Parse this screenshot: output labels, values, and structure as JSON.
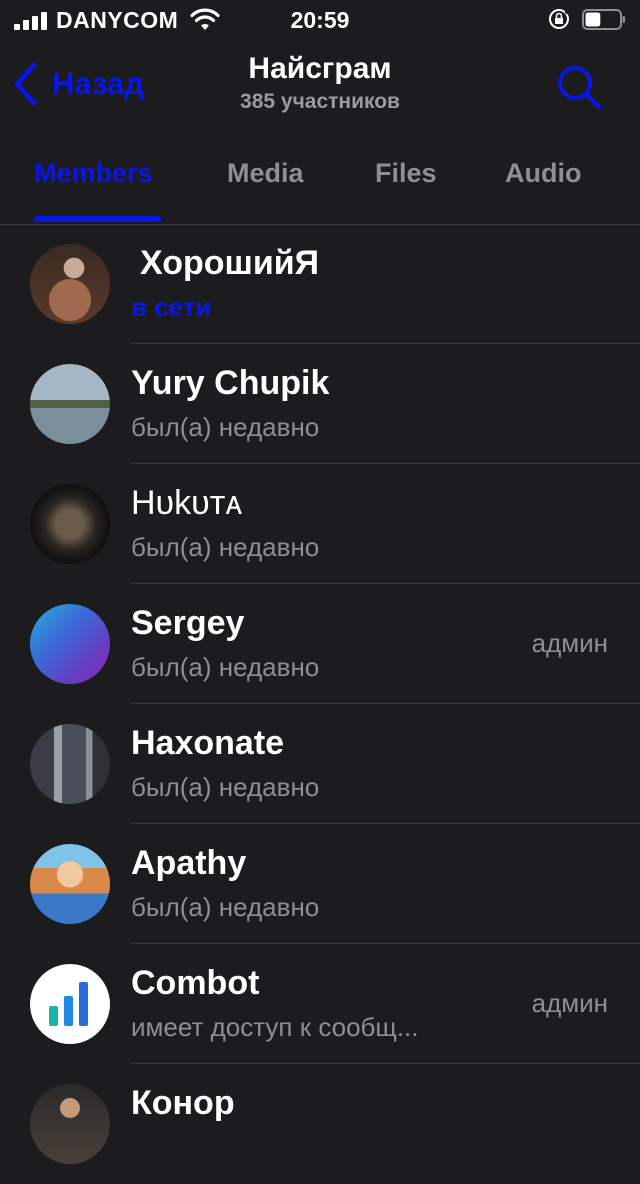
{
  "status_bar": {
    "carrier": "DANYCOM",
    "time": "20:59",
    "battery_level": 0.45
  },
  "nav": {
    "back_label": "Назад",
    "title": "Найсграм",
    "subtitle": "385 участников"
  },
  "tabs": [
    {
      "label": "Members",
      "active": true
    },
    {
      "label": "Media",
      "active": false
    },
    {
      "label": "Files",
      "active": false
    },
    {
      "label": "Audio",
      "active": false
    }
  ],
  "members": [
    {
      "name": "ХорошийЯ",
      "status": "в сети",
      "role": ""
    },
    {
      "name": "Yury Chupik",
      "status": "был(а) недавно",
      "role": ""
    },
    {
      "name": "Hυkυтᴀ",
      "status": "был(а) недавно",
      "role": ""
    },
    {
      "name": "Sergey",
      "status": "был(а) недавно",
      "role": "админ"
    },
    {
      "name": "Haxonate",
      "status": "был(а) недавно",
      "role": ""
    },
    {
      "name": "Apathy",
      "status": "был(а) недавно",
      "role": ""
    },
    {
      "name": "Combot",
      "status": "имеет доступ к сообщ...",
      "role": "админ"
    },
    {
      "name": "Конор",
      "status": "",
      "role": ""
    }
  ],
  "colors": {
    "accent": "#0a16e6",
    "background": "#1c1c1e",
    "secondary_text": "#8e8e93",
    "separator": "#38383a"
  },
  "icons": {
    "back": "chevron-left-icon",
    "search": "search-icon",
    "wifi": "wifi-icon",
    "signal": "cellular-signal-icon",
    "lock": "orientation-lock-icon",
    "battery": "battery-icon"
  }
}
